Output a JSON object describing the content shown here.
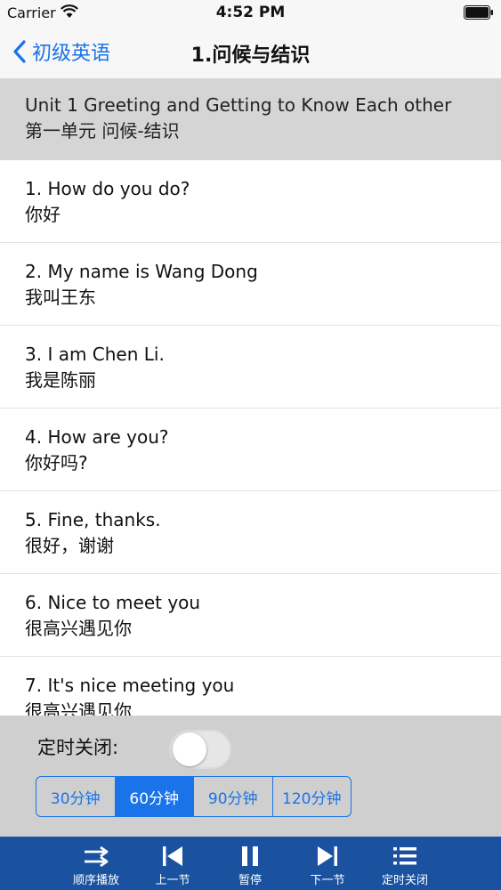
{
  "status_bar": {
    "carrier": "Carrier",
    "time": "4:52 PM"
  },
  "nav": {
    "back_label": "初级英语",
    "title": "1.问候与结识"
  },
  "unit": {
    "title_en": "Unit 1  Greeting and Getting to Know Each other",
    "title_zh": "第一单元 问候-结识"
  },
  "sentences": [
    {
      "en": "1.  How do you do?",
      "zh": "你好"
    },
    {
      "en": "2.  My name is Wang Dong",
      "zh": "我叫王东"
    },
    {
      "en": "3.  I am Chen Li.",
      "zh": "我是陈丽"
    },
    {
      "en": "4.  How are you?",
      "zh": "你好吗?"
    },
    {
      "en": "5.  Fine, thanks.",
      "zh": "很好，谢谢"
    },
    {
      "en": "6.  Nice to meet you",
      "zh": "很高兴遇见你"
    },
    {
      "en": "7.  It's nice meeting you",
      "zh": "很高兴遇见你"
    }
  ],
  "timer": {
    "label": "定时关闭:",
    "enabled": false,
    "options": [
      "30分钟",
      "60分钟",
      "90分钟",
      "120分钟"
    ],
    "selected_index": 1
  },
  "toolbar": {
    "items": [
      {
        "label": "顺序播放",
        "icon": "sequential-play-icon"
      },
      {
        "label": "上一节",
        "icon": "previous-icon"
      },
      {
        "label": "暂停",
        "icon": "pause-icon"
      },
      {
        "label": "下一节",
        "icon": "next-icon"
      },
      {
        "label": "定时关闭",
        "icon": "list-icon"
      }
    ]
  },
  "colors": {
    "accent": "#1a73e8",
    "toolbar_bg": "#1a52a0",
    "header_bg": "#d5d5d5",
    "panel_bg": "#cfcfcf"
  }
}
